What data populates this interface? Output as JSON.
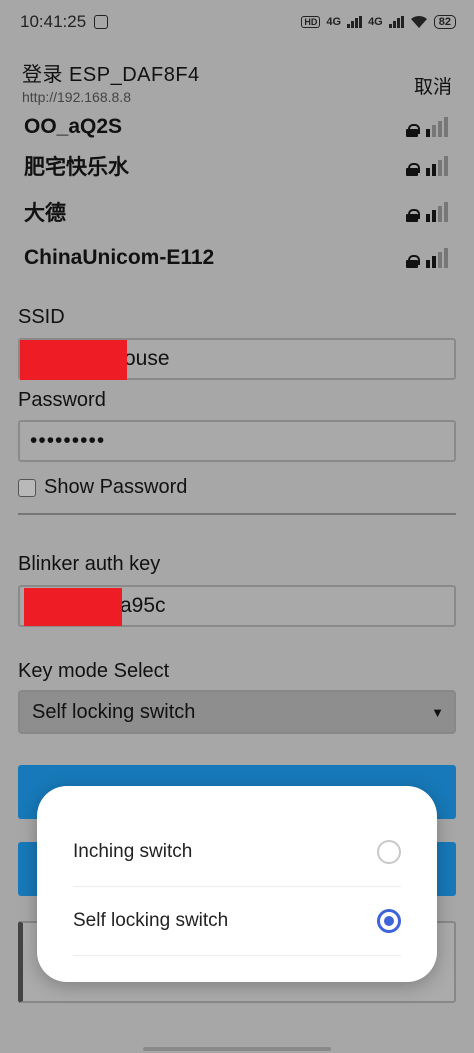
{
  "status_bar": {
    "time": "10:41:25",
    "signal_1": "4G",
    "signal_2": "4G",
    "battery": "82",
    "hd": "HD"
  },
  "header": {
    "title": "登录 ESP_DAF8F4",
    "url": "http://192.168.8.8",
    "cancel_label": "取消"
  },
  "wifi_list": [
    {
      "name": "OO_aQ2S",
      "bars": 1
    },
    {
      "name": "肥宅快乐水",
      "bars": 2
    },
    {
      "name": "大德",
      "bars": 2
    },
    {
      "name": "ChinaUnicom-E112",
      "bars": 2
    }
  ],
  "form": {
    "ssid_label": "SSID",
    "ssid_value_visible": "ouse",
    "password_label": "Password",
    "password_value": "•••••••••",
    "show_password_label": "Show Password",
    "auth_key_label": "Blinker auth key",
    "auth_key_value_visible": "a95c",
    "key_mode_label": "Key mode Select",
    "key_mode_selected": "Self locking switch"
  },
  "dialog": {
    "options": [
      {
        "label": "Inching switch",
        "selected": false
      },
      {
        "label": "Self locking switch",
        "selected": true
      }
    ]
  },
  "colors": {
    "accent": "#3f63d9",
    "button_blue": "#1779b9",
    "redaction": "#ee1c25",
    "overlay_bg": "#a7a7a7"
  },
  "icons": [
    "wifi-lock-icon",
    "wifi-signal-icon",
    "checkbox-icon",
    "dropdown-arrow-icon",
    "radio-icon",
    "wifi-status-icon",
    "battery-icon"
  ]
}
